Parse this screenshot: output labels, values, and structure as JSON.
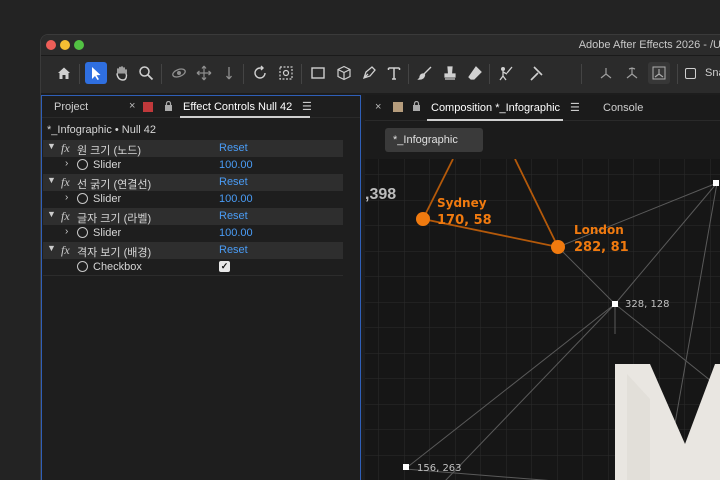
{
  "app": {
    "title": "Adobe After Effects 2026 - /U"
  },
  "toolbar": {
    "snap_label": "Sna",
    "tools": [
      "home-icon",
      "selection-icon",
      "hand-icon",
      "zoom-icon",
      "orbit-icon",
      "pan-icon",
      "dolly-icon",
      "rotate-icon",
      "anchor-icon",
      "rectangle-icon",
      "cube-icon",
      "pen-icon",
      "type-icon",
      "brush-icon",
      "clone-stamp-icon",
      "eraser-icon",
      "roto-brush-icon",
      "puppet-pin-icon",
      "axis-local-icon",
      "axis-world-icon",
      "axis-view-icon"
    ]
  },
  "left_panel": {
    "tab_project": "Project",
    "tab_effect_controls": "Effect Controls Null 42",
    "layer_title": "*_Infographic • Null 42",
    "effects": [
      {
        "name": "원 크기 (노드)",
        "reset": "Reset",
        "param": "Slider",
        "value": "100.00"
      },
      {
        "name": "선 굵기 (연결선)",
        "reset": "Reset",
        "param": "Slider",
        "value": "100.00"
      },
      {
        "name": "글자 크기 (라벨)",
        "reset": "Reset",
        "param": "Slider",
        "value": "100.00"
      },
      {
        "name": "격자 보기 (배경)",
        "reset": "Reset",
        "param": "Checkbox",
        "value": "✓"
      }
    ]
  },
  "right_panel": {
    "tab_composition": "Composition *_Infographic",
    "tab_console": "Console",
    "comp_subtab": "*_Infographic",
    "nodes": [
      {
        "name": "Sydney",
        "coords": "170, 58"
      },
      {
        "name": "London",
        "coords": "282, 81"
      },
      {
        "name": "",
        "coords": "328, 128"
      },
      {
        "name": "",
        "coords": "156, 263"
      },
      {
        "name": "",
        "coords": ",398"
      }
    ]
  },
  "colors": {
    "accent_orange": "#f07a0f",
    "link_blue": "#4a9cf5",
    "active_tool": "#2f6fe0",
    "swatch_red": "#c0393b",
    "swatch_tan": "#b59c7c"
  }
}
